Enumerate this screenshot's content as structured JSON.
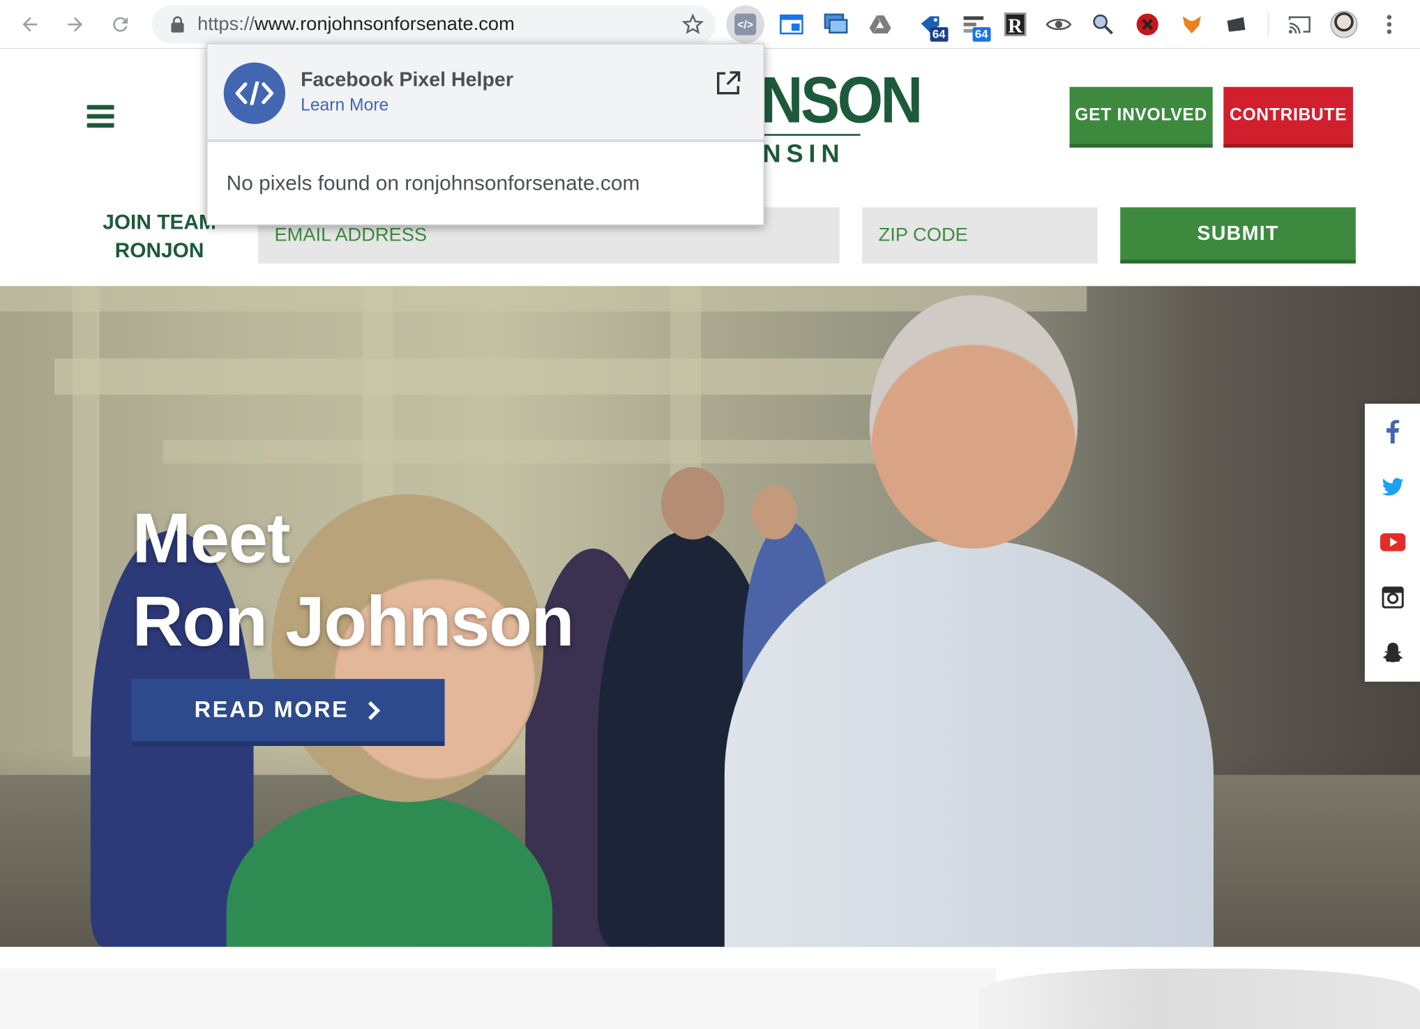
{
  "browser": {
    "url_scheme": "https://",
    "url_host": "www.ronjohnsonforsenate.com",
    "extensions": [
      {
        "name": "pixel-helper-icon",
        "badge": ""
      },
      {
        "name": "window-icon",
        "badge": ""
      },
      {
        "name": "screens-icon",
        "badge": ""
      },
      {
        "name": "drive-icon",
        "badge": ""
      },
      {
        "name": "tag-icon",
        "badge": "64"
      },
      {
        "name": "network-icon",
        "badge": "64"
      },
      {
        "name": "r-icon",
        "badge": ""
      },
      {
        "name": "eye-icon",
        "badge": ""
      },
      {
        "name": "magnifier-icon",
        "badge": ""
      },
      {
        "name": "blocker-icon",
        "badge": ""
      },
      {
        "name": "fox-icon",
        "badge": ""
      },
      {
        "name": "folder-icon",
        "badge": ""
      },
      {
        "name": "cast-icon",
        "badge": ""
      },
      {
        "name": "profile-avatar",
        "badge": ""
      }
    ]
  },
  "popup": {
    "title": "Facebook Pixel Helper",
    "link": "Learn More",
    "message": "No pixels found on ronjohnsonforsenate.com"
  },
  "header": {
    "logo_text": "NSON",
    "logo_sub": "NSIN",
    "get_involved": "GET INVOLVED",
    "contribute": "CONTRIBUTE"
  },
  "signup": {
    "join_line1": "JOIN TEAM",
    "join_line2": "RONJON",
    "email_placeholder": "EMAIL ADDRESS",
    "zip_placeholder": "ZIP CODE",
    "submit": "SUBMIT"
  },
  "hero": {
    "title_line1": "Meet",
    "title_line2": "Ron Johnson",
    "read_more": "READ MORE"
  },
  "social": [
    "facebook-icon",
    "twitter-icon",
    "youtube-icon",
    "instagram-icon",
    "snapchat-icon"
  ],
  "colors": {
    "brand_green": "#1d5a3a",
    "button_green": "#3d8a3f",
    "contribute_red": "#d11f2d",
    "read_more_blue": "#2c4a8c",
    "facebook_blue": "#4266b2",
    "youtube_red": "#e52d27",
    "twitter_blue": "#1da1f2"
  }
}
